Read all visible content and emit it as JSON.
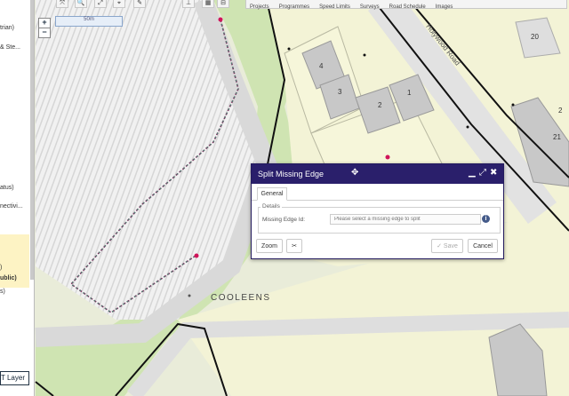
{
  "left_panel": {
    "items": [
      "trian)",
      "& Ste...",
      "atus)",
      "nectivi...",
      ")",
      "ublic)",
      "s)"
    ],
    "layer_button_label": "T Layer"
  },
  "toolbar": {
    "tools": [
      "⤧",
      "🔍",
      "⤢",
      "⌖",
      "✎",
      "⊥",
      "▦",
      "⊟"
    ],
    "menus": [
      "Projects",
      "Programmes",
      "Speed Limits",
      "Surveys",
      "Road Schedule",
      "Images"
    ]
  },
  "map": {
    "zoom_in": "+",
    "zoom_out": "−",
    "scale_label": "50m",
    "street_label": "Holywood Road",
    "place_label": "COOLEENS",
    "house_numbers": [
      "4",
      "3",
      "2",
      "1",
      "20",
      "21",
      "2"
    ]
  },
  "dialog": {
    "title": "Split Missing Edge",
    "tab": "General",
    "section": "Details",
    "field_label": "Missing Edge Id:",
    "field_placeholder": "Please select a missing edge to split",
    "buttons": {
      "zoom": "Zoom",
      "save": "Save",
      "cancel": "Cancel"
    }
  }
}
